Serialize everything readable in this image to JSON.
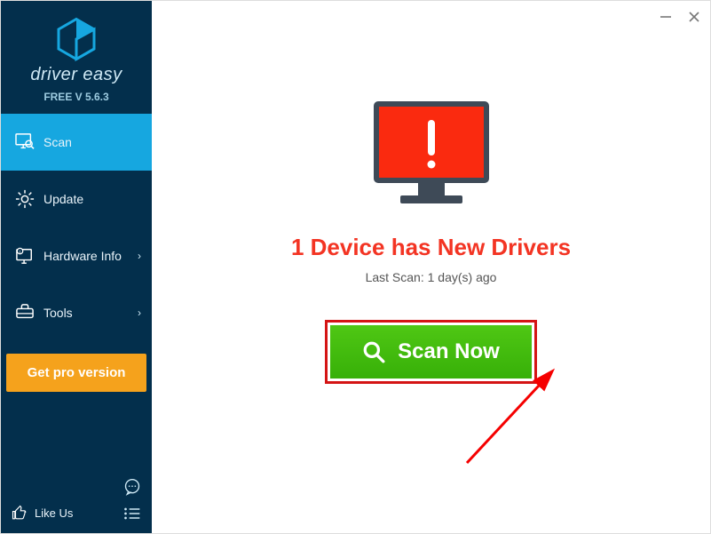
{
  "brand": {
    "name": "driver easy",
    "version": "FREE V 5.6.3"
  },
  "sidebar": {
    "items": [
      {
        "label": "Scan"
      },
      {
        "label": "Update"
      },
      {
        "label": "Hardware Info"
      },
      {
        "label": "Tools"
      }
    ],
    "pro_label": "Get pro version",
    "like_label": "Like Us"
  },
  "main": {
    "headline": "1 Device has New Drivers",
    "subtext": "Last Scan: 1 day(s) ago",
    "scan_label": "Scan Now"
  }
}
